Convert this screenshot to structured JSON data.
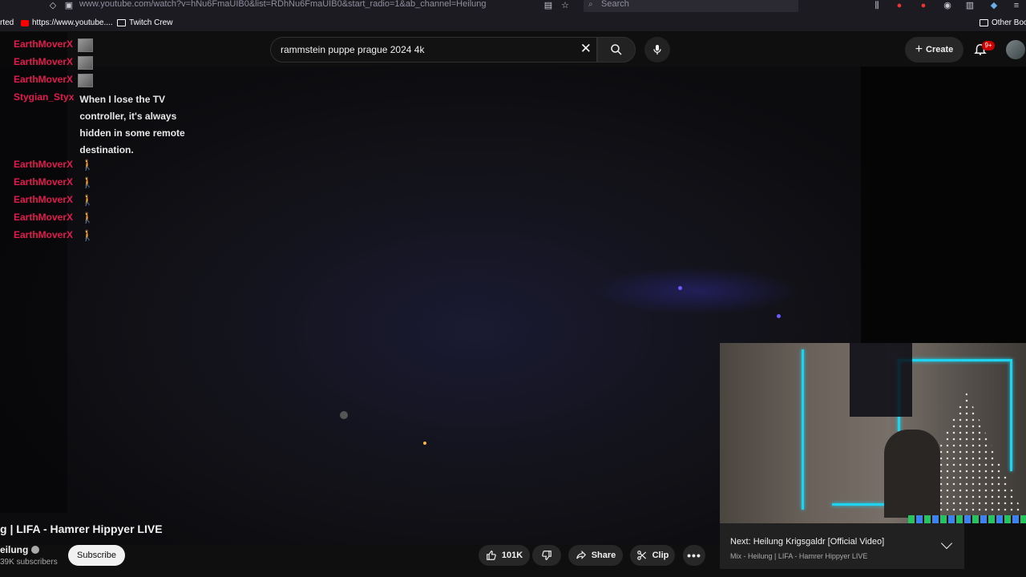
{
  "browser": {
    "url": "www.youtube.com/watch?v=hNu6FmaUIB0&list=RDhNu6FmaUIB0&start_radio=1&ab_channel=Heilung",
    "search_placeholder": "Search"
  },
  "bookmarks": [
    {
      "label": "rted",
      "icon": "none"
    },
    {
      "label": "https://www.youtube....",
      "icon": "youtube-icon"
    },
    {
      "label": "Twitch Crew",
      "icon": "folder-icon"
    },
    {
      "label": "Other Book",
      "icon": "folder-icon"
    }
  ],
  "header": {
    "search_query": "rammstein puppe prague 2024 4k",
    "create_label": "Create",
    "notification_count": "9+"
  },
  "chat": [
    {
      "user": "EarthMoverX",
      "emote": "rock"
    },
    {
      "user": "EarthMoverX",
      "emote": "rock"
    },
    {
      "user": "EarthMoverX",
      "emote": "rock"
    },
    {
      "user": "Stygian_Styx",
      "message": "When I lose the TV controller, it's always hidden in some remote destination."
    },
    {
      "user": "EarthMoverX",
      "emote": "walking-man"
    },
    {
      "user": "EarthMoverX",
      "emote": "walking-man"
    },
    {
      "user": "EarthMoverX",
      "emote": "walking-man"
    },
    {
      "user": "EarthMoverX",
      "emote": "walking-man"
    },
    {
      "user": "EarthMoverX",
      "emote": "walking-man"
    }
  ],
  "video": {
    "title": "g | LIFA - Hamrer Hippyer LIVE",
    "channel": "eilung",
    "subscribers": "39K subscribers",
    "subscribe_label": "Subscribe",
    "likes": "101K",
    "share_label": "Share",
    "clip_label": "Clip"
  },
  "miniplayer": {
    "next_title": "Next: Heilung Krigsgaldr [Official Video]",
    "next_subtitle": "Mix - Heilung | LIFA - Hamrer Hippyer LIVE"
  },
  "colors": {
    "chat_user": "#e31b4f",
    "emote_green": "#3ee84a",
    "neon": "#1ed3ef"
  }
}
